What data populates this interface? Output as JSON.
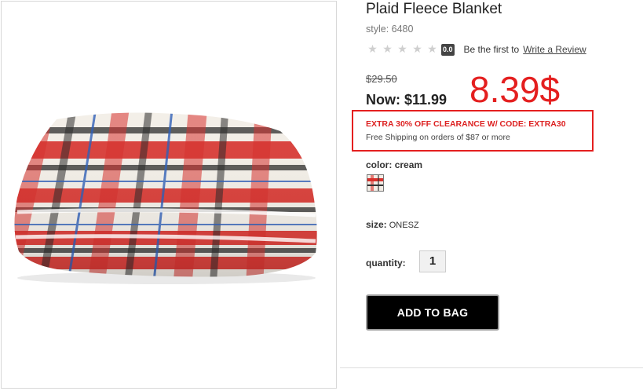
{
  "product": {
    "title": "Plaid Fleece Blanket",
    "style": "style: 6480",
    "rating_badge": "0.0",
    "review_prompt": "Be the first to",
    "review_link": "Write a Review",
    "original_price": "$29.50",
    "now_price": "Now: $11.99",
    "promo_code_text": "EXTRA 30% OFF CLEARANCE W/ CODE: EXTRA30",
    "shipping_text": "Free Shipping on orders of $87 or more",
    "color_key": "color:",
    "color_value": "cream",
    "size_key": "size:",
    "size_value": "ONESZ",
    "quantity_label": "quantity:",
    "quantity_value": "1",
    "add_to_bag": "ADD TO BAG",
    "stars": 0
  },
  "annotation": {
    "price_note": "8.39$"
  },
  "colors": {
    "annotation_red": "#e41f1f",
    "promo_red": "#dd2222",
    "button_black": "#000000"
  },
  "icons": [
    "star-icon",
    "plaid-swatch"
  ]
}
